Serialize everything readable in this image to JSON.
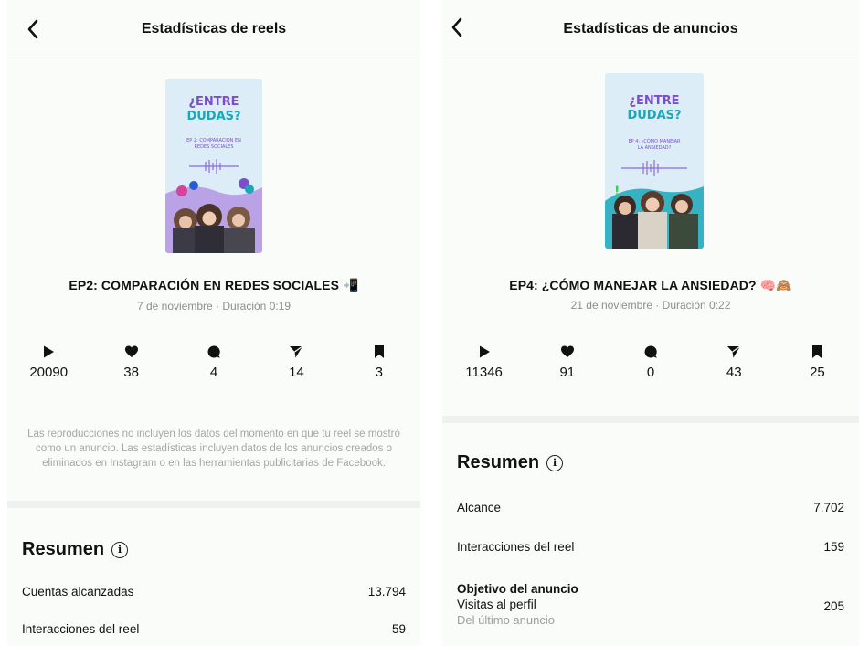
{
  "left": {
    "header_title": "Estadísticas de reels",
    "thumb_logo_line1": "¿ENTRE",
    "thumb_logo_line2": "DUDAS?",
    "thumb_caption_line1": "EP 2: COMPARACIÓN EN",
    "thumb_caption_line2": "REDES SOCIALES",
    "reel_title": "EP2: COMPARACIÓN EN REDES SOCIALES 📲",
    "reel_meta": "7 de noviembre · Duración 0:19",
    "stats": {
      "plays": "20090",
      "likes": "38",
      "comments": "4",
      "shares": "14",
      "saves": "3"
    },
    "note": "Las reproducciones no incluyen los datos del momento en que tu reel se mostró como un anuncio. Las estadísticas incluyen datos de los anuncios creados o eliminados en Instagram o en las herramientas publicitarias de Facebook.",
    "summary_title": "Resumen",
    "rows": [
      {
        "label": "Cuentas alcanzadas",
        "value": "13.794"
      },
      {
        "label": "Interacciones del reel",
        "value": "59"
      }
    ]
  },
  "right": {
    "header_title": "Estadísticas de anuncios",
    "thumb_logo_line1": "¿ENTRE",
    "thumb_logo_line2": "DUDAS?",
    "thumb_caption_line1": "EP 4: ¿CÓMO MANEJAR",
    "thumb_caption_line2": "LA ANSIEDAD?",
    "reel_title": "EP4: ¿CÓMO MANEJAR LA ANSIEDAD? 🧠🙈",
    "reel_meta": "21 de noviembre · Duración 0:22",
    "stats": {
      "plays": "11346",
      "likes": "91",
      "comments": "0",
      "shares": "43",
      "saves": "25"
    },
    "summary_title": "Resumen",
    "rows": [
      {
        "label": "Alcance",
        "value": "7.702"
      },
      {
        "label": "Interacciones del reel",
        "value": "159"
      }
    ],
    "objective": {
      "title": "Objetivo del anuncio",
      "label": "Visitas al perfil",
      "value": "205",
      "note": "Del último anuncio"
    }
  },
  "colors": {
    "brand_purple": "#7b4fc9",
    "brand_teal": "#1aa7b8",
    "muted": "#8a8f8c"
  },
  "icons": [
    "back-chevron-icon",
    "play-icon",
    "heart-icon",
    "comment-icon",
    "send-icon",
    "bookmark-icon",
    "info-icon"
  ]
}
